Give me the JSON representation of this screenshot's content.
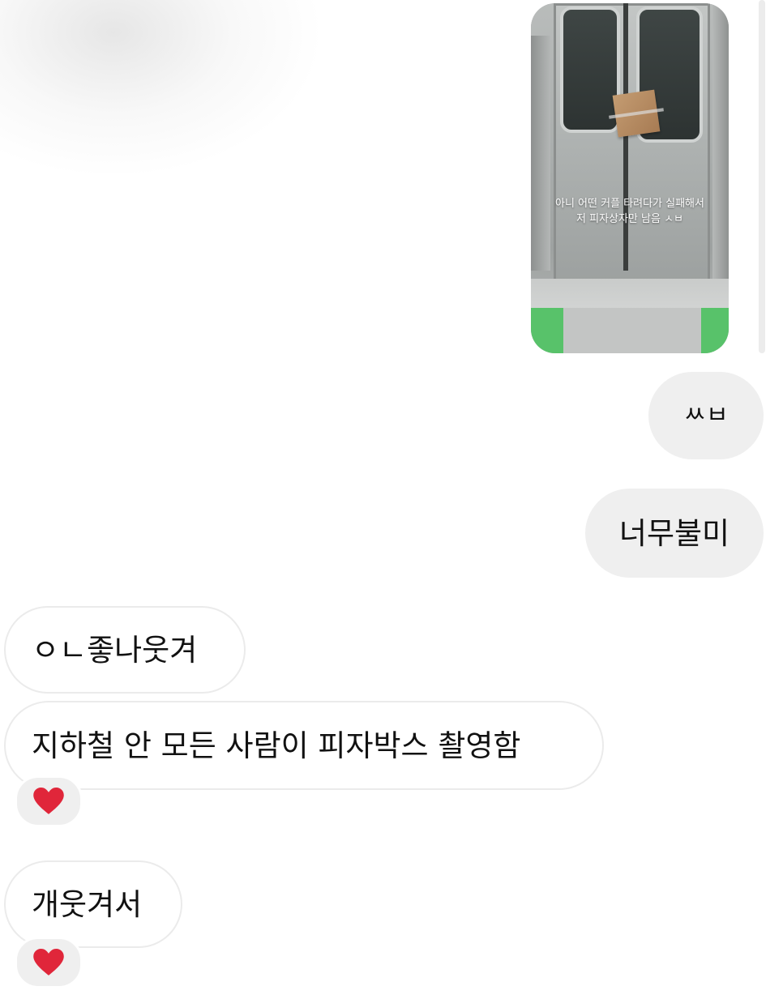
{
  "story_reply": {
    "caption_line1": "아니 어떤 커플 타려다가 실패해서",
    "caption_line2": "저 피자상자만 남음 ㅅㅂ"
  },
  "messages": [
    {
      "sender": "me",
      "text": "ㅆㅂ"
    },
    {
      "sender": "me",
      "text": "너무불미"
    },
    {
      "sender": "them",
      "text": "ㅇㄴ좋나웃겨"
    },
    {
      "sender": "them",
      "text": "지하철 안 모든 사람이 피자박스 촬영함",
      "reaction": "heart-icon"
    },
    {
      "sender": "them",
      "text": "개웃겨서",
      "reaction": "heart-icon"
    }
  ],
  "colors": {
    "sent_bubble": "#efefef",
    "received_bubble_border": "#ebebeb",
    "heart": "#e0263a"
  }
}
